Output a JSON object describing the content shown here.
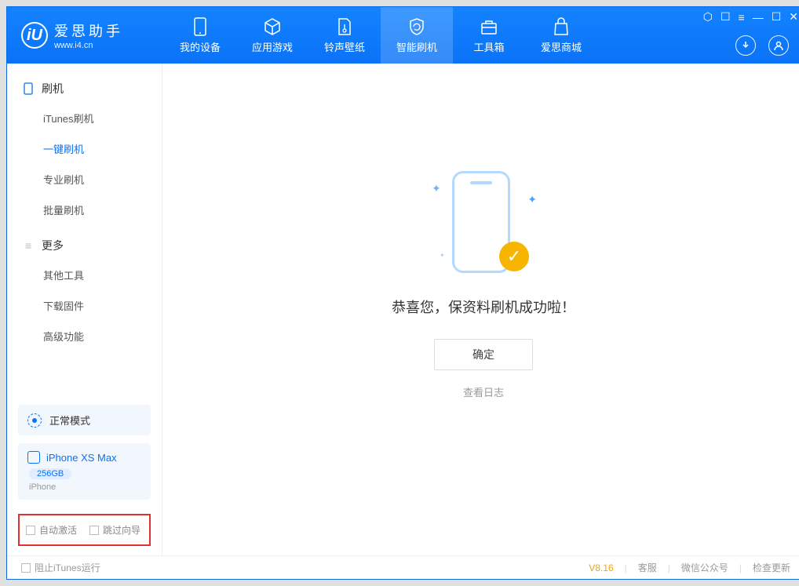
{
  "brand": {
    "title": "爱思助手",
    "url": "www.i4.cn",
    "logo_letter": "iU"
  },
  "tabs": [
    {
      "label": "我的设备"
    },
    {
      "label": "应用游戏"
    },
    {
      "label": "铃声壁纸"
    },
    {
      "label": "智能刷机"
    },
    {
      "label": "工具箱"
    },
    {
      "label": "爱思商城"
    }
  ],
  "sidebar": {
    "section1_title": "刷机",
    "items1": [
      {
        "label": "iTunes刷机"
      },
      {
        "label": "一键刷机"
      },
      {
        "label": "专业刷机"
      },
      {
        "label": "批量刷机"
      }
    ],
    "section2_title": "更多",
    "items2": [
      {
        "label": "其他工具"
      },
      {
        "label": "下载固件"
      },
      {
        "label": "高级功能"
      }
    ]
  },
  "mode": {
    "label": "正常模式"
  },
  "device": {
    "name": "iPhone XS Max",
    "storage": "256GB",
    "type": "iPhone"
  },
  "options": {
    "auto_activate": "自动激活",
    "skip_guide": "跳过向导"
  },
  "main": {
    "success_message": "恭喜您，保资料刷机成功啦！",
    "ok_button": "确定",
    "view_log": "查看日志"
  },
  "footer": {
    "block_itunes": "阻止iTunes运行",
    "version": "V8.16",
    "service": "客服",
    "wechat": "微信公众号",
    "update": "检查更新"
  }
}
